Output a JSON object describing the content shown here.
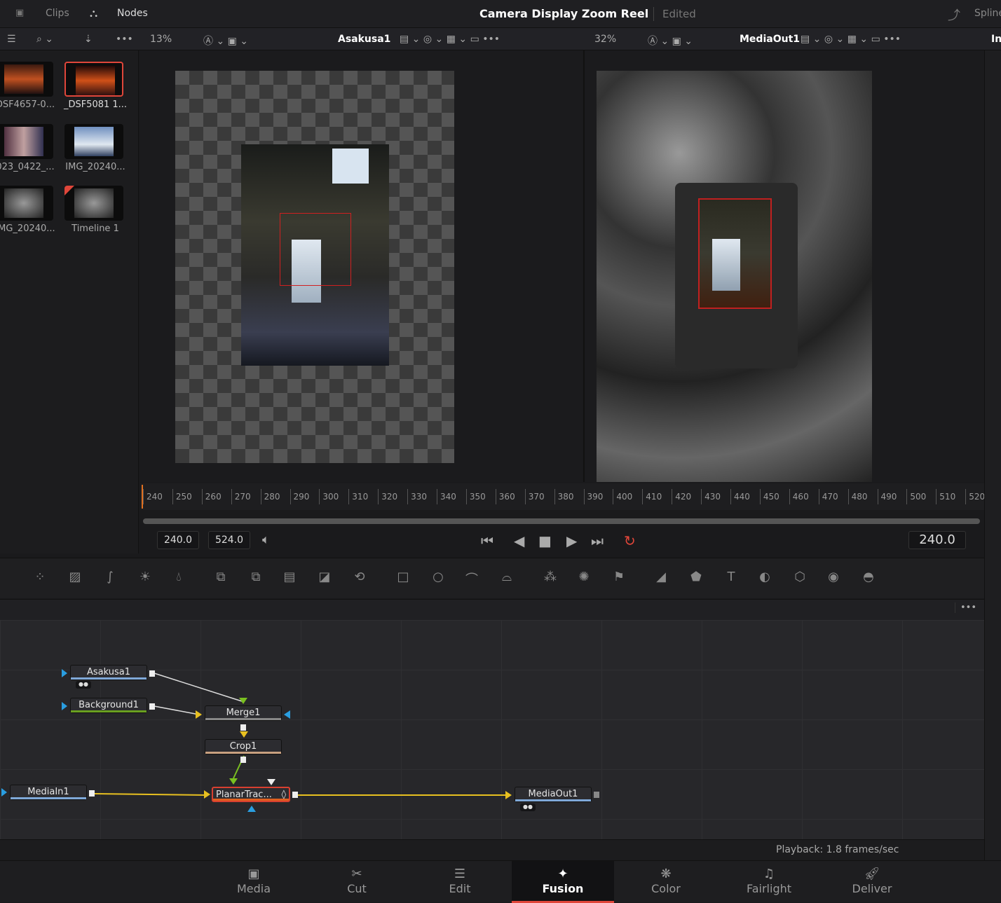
{
  "topbar": {
    "clips": "Clips",
    "nodes": "Nodes",
    "title": "Camera Display Zoom Reel",
    "state": "Edited",
    "spline": "Spline"
  },
  "toolbar": {
    "zoom_left": "13%",
    "viewer_left": "Asakusa1",
    "zoom_right": "32%",
    "viewer_right": "MediaOut1",
    "inspector": "In"
  },
  "media_pool": [
    {
      "label": "DSF4657-0..."
    },
    {
      "label": "_DSF5081 1...",
      "selected": true
    },
    {
      "label": "023_0422_..."
    },
    {
      "label": "IMG_20240..."
    },
    {
      "label": "IMG_20240..."
    },
    {
      "label": "Timeline 1"
    }
  ],
  "ruler": {
    "ticks": [
      "240",
      "250",
      "260",
      "270",
      "280",
      "290",
      "300",
      "310",
      "320",
      "330",
      "340",
      "350",
      "360",
      "370",
      "380",
      "390",
      "400",
      "410",
      "420",
      "430",
      "440",
      "450",
      "460",
      "470",
      "480",
      "490",
      "500",
      "510",
      "520"
    ]
  },
  "transport": {
    "in": "240.0",
    "out": "524.0",
    "current": "240.0"
  },
  "nodes": {
    "asakusa": "Asakusa1",
    "background": "Background1",
    "merge": "Merge1",
    "crop": "Crop1",
    "mediain": "MediaIn1",
    "planar": "PlanarTrac...",
    "mediaout": "MediaOut1"
  },
  "status": {
    "playback": "Playback: 1.8 frames/sec"
  },
  "pages": [
    {
      "label": "Media",
      "icon": "media-icon"
    },
    {
      "label": "Cut",
      "icon": "cut-icon"
    },
    {
      "label": "Edit",
      "icon": "edit-icon"
    },
    {
      "label": "Fusion",
      "icon": "fusion-icon",
      "active": true
    },
    {
      "label": "Color",
      "icon": "color-icon"
    },
    {
      "label": "Fairlight",
      "icon": "fairlight-icon"
    },
    {
      "label": "Deliver",
      "icon": "deliver-icon"
    }
  ],
  "colors": {
    "accent": "#e0463a",
    "yellow_link": "#e8c020",
    "active_tab": "#e0463a"
  }
}
